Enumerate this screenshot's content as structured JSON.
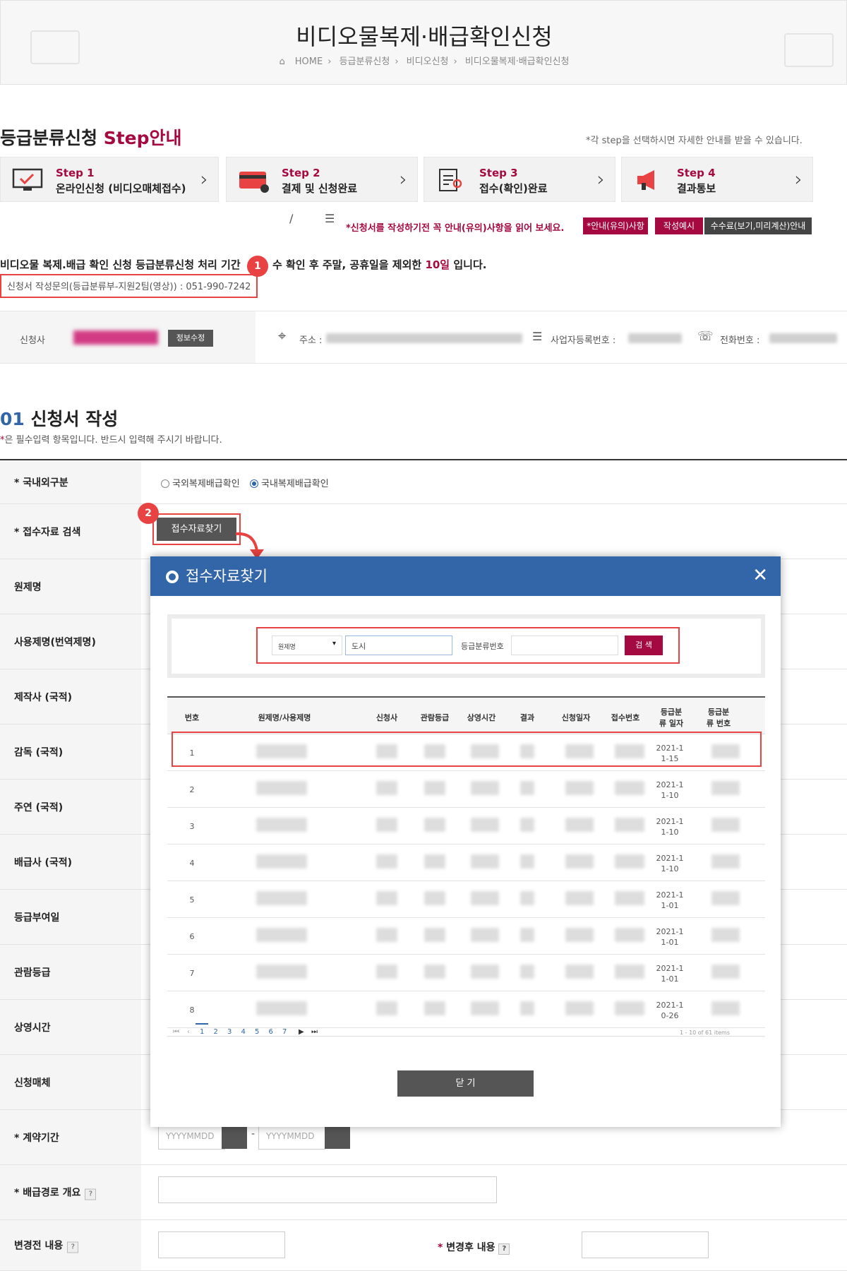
{
  "header": {
    "title": "비디오물복제·배급확인신청",
    "breadcrumb": [
      "HOME",
      "등급분류신청",
      "비디오신청",
      "비디오물복제·배급확인신청"
    ]
  },
  "steps_section": {
    "title_black": "등급분류신청 ",
    "title_red": "Step안내",
    "note": "*각 step을 선택하시면 자세한 안내를 받을 수 있습니다.",
    "steps": [
      {
        "label": "Step 1",
        "desc": "온라인신청 (비디오매체접수)",
        "icon": "monitor-check-icon"
      },
      {
        "label": "Step 2",
        "desc": "결제 및 신청완료",
        "icon": "credit-card-icon"
      },
      {
        "label": "Step 3",
        "desc": "접수(확인)완료",
        "icon": "document-search-icon"
      },
      {
        "label": "Step 4",
        "desc": "결과통보",
        "icon": "megaphone-icon"
      }
    ]
  },
  "notice": {
    "text": "*신청서를 작성하기전 꼭 안내(유의)사항을 읽어 보세요.",
    "buttons": [
      "*안내(유의)사항",
      "작성예시",
      "수수료(보기,미리계산)안내"
    ]
  },
  "period": {
    "text_a": "비디오물 복제.배급 확인 신청 등급분류신청 처리 기간",
    "text_b": "수 확인 후 주말, 공휴일을 제외한 ",
    "days": "10일",
    "text_c": " 입니다.",
    "contact": "신청서 작성문의(등급분류부-지원2팀(영상)) : 051-990-7242"
  },
  "applicant": {
    "label": "신청사",
    "edit_button": "정보수정",
    "address_label": "주소 :",
    "bizno_label": "사업자등록번호 :",
    "phone_label": "전화번호 :"
  },
  "form": {
    "title_num": "01",
    "title": " 신청서 작성",
    "req_note": "은 필수입력 항목입니다. 반드시 입력해 주시기 바랍니다.",
    "req_mark": "*",
    "fields": [
      {
        "label": "국내외구분",
        "req": true
      },
      {
        "label": "접수자료 검색",
        "req": true
      },
      {
        "label": "원제명"
      },
      {
        "label": "사용제명(번역제명)"
      },
      {
        "label": "제작사 (국적)"
      },
      {
        "label": "감독 (국적)"
      },
      {
        "label": "주연 (국적)"
      },
      {
        "label": "배급사 (국적)"
      },
      {
        "label": "등급부여일"
      },
      {
        "label": "관람등급"
      },
      {
        "label": "상영시간"
      },
      {
        "label": "신청매체"
      },
      {
        "label": "계약기간",
        "req": true
      },
      {
        "label": "배급경로 개요",
        "req": true,
        "help": "?"
      },
      {
        "label": "변경전 내용",
        "help": "?"
      }
    ],
    "radios": [
      "국외복제배급확인",
      "국내복제배급확인"
    ],
    "search_button": "접수자료찾기",
    "date_placeholder": "YYYYMMDD",
    "date_sep": "-",
    "after_label": "변경후 내용",
    "after_help": "?"
  },
  "badges": [
    "1",
    "2"
  ],
  "modal": {
    "title": "접수자료찾기",
    "select_value": "원제명",
    "search_value": "도시",
    "grade_label": "등급분류번호",
    "search_button": "검 색",
    "columns": [
      "번호",
      "원제명/사용제명",
      "신청사",
      "관람등급",
      "상영시간",
      "결과",
      "신청일자",
      "접수번호",
      "등급분류 일자",
      "등급분류 번호"
    ],
    "rows": [
      {
        "no": "1",
        "date": "2021-11-15"
      },
      {
        "no": "2",
        "date": "2021-11-10"
      },
      {
        "no": "3",
        "date": "2021-11-10"
      },
      {
        "no": "4",
        "date": "2021-11-10"
      },
      {
        "no": "5",
        "date": "2021-11-01"
      },
      {
        "no": "6",
        "date": "2021-11-01"
      },
      {
        "no": "7",
        "date": "2021-11-01"
      },
      {
        "no": "8",
        "date": "2021-10-26"
      }
    ],
    "pages": [
      "1",
      "2",
      "3",
      "4",
      "5",
      "6",
      "7"
    ],
    "items_info": "1 - 10 of 61 items",
    "close_button": "닫 기"
  }
}
